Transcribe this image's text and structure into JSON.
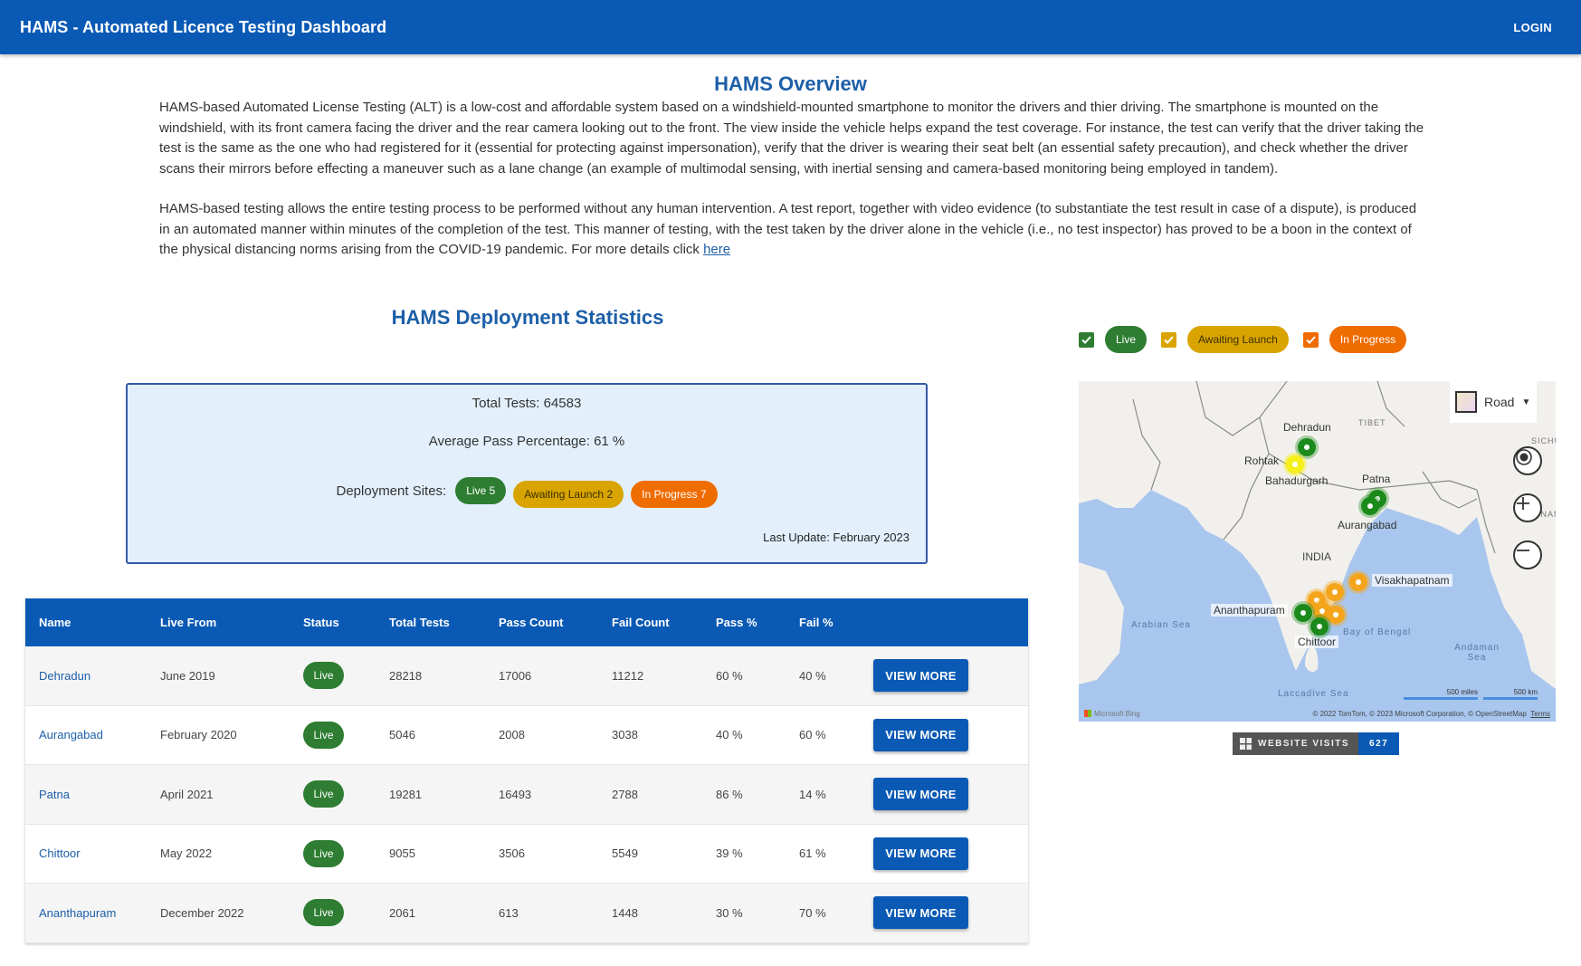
{
  "appbar": {
    "title": "HAMS - Automated Licence Testing Dashboard",
    "login_label": "LOGIN",
    "color": "#0a5ab5"
  },
  "overview": {
    "title": "HAMS Overview",
    "paragraph1": "HAMS-based Automated License Testing (ALT) is a low-cost and affordable system based on a windshield-mounted smartphone to monitor the drivers and thier driving. The smartphone is mounted on the windshield, with its front camera facing the driver and the rear camera looking out to the front. The view inside the vehicle helps expand the test coverage. For instance, the test can verify that the driver taking the test is the same as the one who had registered for it (essential for protecting against impersonation), verify that the driver is wearing their seat belt (an essential safety precaution), and check whether the driver scans their mirrors before effecting a maneuver such as a lane change (an example of multimodal sensing, with inertial sensing and camera-based monitoring being employed in tandem).",
    "paragraph2": "HAMS-based testing allows the entire testing process to be performed without any human intervention. A test report, together with video evidence (to substantiate the test result in case of a dispute), is produced in an automated manner within minutes of the completion of the test. This manner of testing, with the test taken by the driver alone in the vehicle (i.e., no test inspector) has proved to be a boon in the context of the physical distancing norms arising from the COVID-19 pandemic. For more details click ",
    "link_label": "here"
  },
  "stats": {
    "title": "HAMS Deployment Statistics",
    "total_tests": "Total Tests: 64583",
    "avg_pass": "Average Pass Percentage: 61 %",
    "sites_label": "Deployment Sites:",
    "chips": {
      "live": "Live 5",
      "awaiting": "Awaiting Launch 2",
      "in_progress": "In Progress 7"
    },
    "last_update": "Last Update: February 2023"
  },
  "table": {
    "headers": [
      "Name",
      "Live From",
      "Status",
      "Total Tests",
      "Pass Count",
      "Fail Count",
      "Pass %",
      "Fail %"
    ],
    "rows": [
      {
        "name": "Dehradun",
        "live_from": "June 2019",
        "status": "Live",
        "total": "28218",
        "pass": "17006",
        "fail": "11212",
        "pass_pct": "60 %",
        "fail_pct": "40 %",
        "action": "VIEW MORE"
      },
      {
        "name": "Aurangabad",
        "live_from": "February 2020",
        "status": "Live",
        "total": "5046",
        "pass": "2008",
        "fail": "3038",
        "pass_pct": "40 %",
        "fail_pct": "60 %",
        "action": "VIEW MORE"
      },
      {
        "name": "Patna",
        "live_from": "April 2021",
        "status": "Live",
        "total": "19281",
        "pass": "16493",
        "fail": "2788",
        "pass_pct": "86 %",
        "fail_pct": "14 %",
        "action": "VIEW MORE"
      },
      {
        "name": "Chittoor",
        "live_from": "May 2022",
        "status": "Live",
        "total": "9055",
        "pass": "3506",
        "fail": "5549",
        "pass_pct": "39 %",
        "fail_pct": "61 %",
        "action": "VIEW MORE"
      },
      {
        "name": "Ananthapuram",
        "live_from": "December 2022",
        "status": "Live",
        "total": "2061",
        "pass": "613",
        "fail": "1448",
        "pass_pct": "30 %",
        "fail_pct": "70 %",
        "action": "VIEW MORE"
      }
    ]
  },
  "legend": {
    "items": [
      {
        "label": "Live",
        "checked": true,
        "color": "#2e7d32"
      },
      {
        "label": "Awaiting Launch",
        "checked": true,
        "color": "#d9a400"
      },
      {
        "label": "In Progress",
        "checked": true,
        "color": "#ef6c00"
      }
    ]
  },
  "map": {
    "style_label": "Road",
    "labels": {
      "dehradun": "Dehradun",
      "rohtak": "Rohtak",
      "bahadurgarh": "Bahadurgarh",
      "patna": "Patna",
      "aurangabad": "Aurangabad",
      "india": "INDIA",
      "visakhapatnam": "Visakhapatnam",
      "ananthapuram": "Ananthapuram",
      "chittoor": "Chittoor",
      "tibet": "TIBET",
      "sichuan": "SICHU",
      "yunnan": "NNAN",
      "arabian_sea": "Arabian Sea",
      "bay_of_bengal": "Bay of Bengal",
      "andaman_sea": "Andaman Sea",
      "laccadive_sea": "Laccadive Sea"
    },
    "scale_miles": "500 miles",
    "scale_km": "500 km",
    "attribution": "© 2022 TomTom, © 2023 Microsoft Corporation, © OpenStreetMap",
    "terms_label": "Terms",
    "provider": "Microsoft Bing",
    "colors": {
      "live": "#1b8a1b",
      "awaiting": "#f5ef1a",
      "in_progress": "#f4a51c"
    }
  },
  "visits": {
    "label": "WEBSITE VISITS",
    "count": "627"
  }
}
